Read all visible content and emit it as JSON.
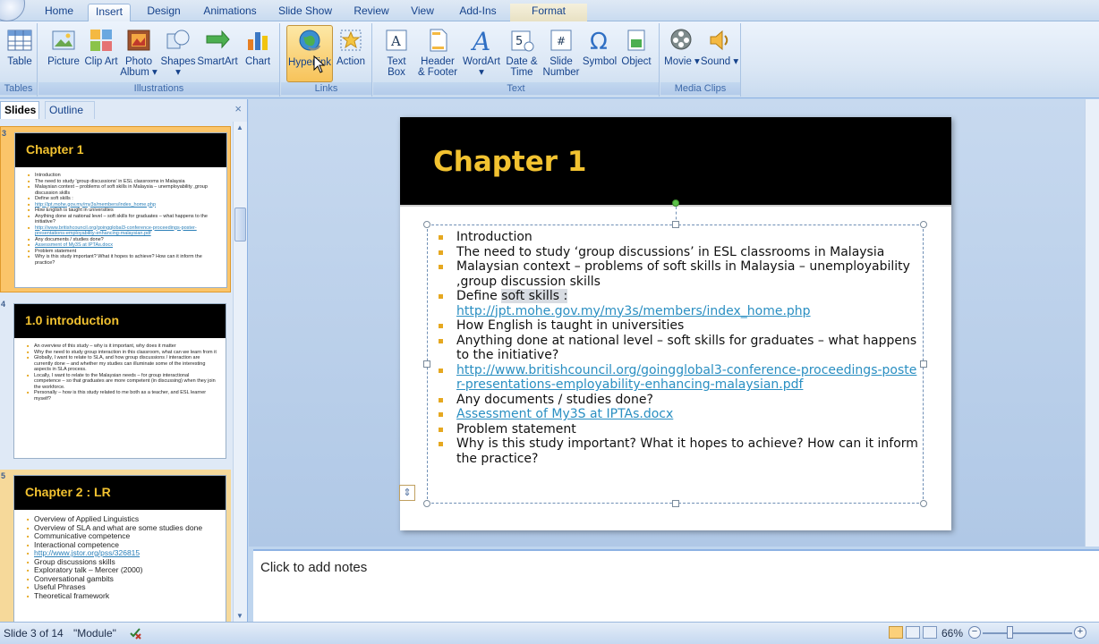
{
  "tabs": [
    "Home",
    "Insert",
    "Design",
    "Animations",
    "Slide Show",
    "Review",
    "View",
    "Add-Ins",
    "Format"
  ],
  "active_tab": "Insert",
  "ribbon": {
    "groups": {
      "tables": "Tables",
      "illustrations": "Illustrations",
      "links": "Links",
      "text": "Text",
      "media": "Media Clips"
    },
    "buttons": {
      "table": "Table",
      "picture": "Picture",
      "clipart": "Clip Art",
      "photoalbum": "Photo Album ▾",
      "shapes": "Shapes ▾",
      "smartart": "SmartArt",
      "chart": "Chart",
      "hyperlink": "Hyperlink",
      "action": "Action",
      "textbox": "Text Box",
      "headerfooter": "Header & Footer",
      "wordart": "WordArt ▾",
      "datetime": "Date & Time",
      "slidenumber": "Slide Number",
      "symbol": "Symbol",
      "object": "Object",
      "movie": "Movie ▾",
      "sound": "Sound ▾"
    }
  },
  "panel": {
    "tabs": [
      "Slides",
      "Outline"
    ],
    "close": "×",
    "thumbs": [
      {
        "number": "3",
        "title": "Chapter 1",
        "lines": [
          "Introduction",
          "The need to study 'group discussions' in ESL classrooms in Malaysia",
          "Malaysian context – problems of soft skills in Malaysia – unemployability ,group discussion skills",
          "Define soft skills :",
          "http://jpt.mohe.gov.my/my3s/members/index_home.php",
          "How English is taught in universities",
          "Anything done at national level – soft skills for graduates – what happens to the initiative?",
          "http://www.britishcouncil.org/goingglobal3-conference-proceedings-poster-presentations-employability-enhancing-malaysian.pdf",
          "Any documents / studies done?",
          "Assessment of My3S at IPTAs.docx",
          "Problem statement",
          "Why is this study important? What it hopes to achieve? How can it inform the practice?"
        ]
      },
      {
        "number": "4",
        "title": "1.0 introduction",
        "lines": [
          "An overview of this study – why is it important, why does it matter",
          "Why the need to study group interaction in this classroom, what can we learn from it",
          "Globally, I want to relate to SLA, and how group discussions / interaction are currently done – and whether my studies can illuminate some of the interesting aspects in SLA process.",
          "Locally, I want to relate to the Malaysian needs – for group interactional competence – so that graduates are more competent (in discussing) when they join the workforce.",
          "Personally – how is this study related to me both as a teacher, and ESL learner myself?"
        ]
      },
      {
        "number": "5",
        "title": "Chapter 2 : LR",
        "lines": [
          "Overview of Applied Linguistics",
          "Overview of SLA and what are some studies done",
          "Communicative competence",
          "Interactional competence",
          "http://www.jstor.org/pss/326815",
          "Group discussions skills",
          "Exploratory talk – Mercer (2000)",
          "Conversational gambits",
          "Useful Phrases",
          "Theoretical framework"
        ]
      }
    ]
  },
  "slide": {
    "title": "Chapter 1",
    "bullets": [
      {
        "text": "Introduction"
      },
      {
        "text": "The need to study ‘group discussions’ in ESL classrooms in Malaysia"
      },
      {
        "text": "Malaysian context – problems of soft skills in Malaysia – unemployability ,group discussion skills"
      },
      {
        "prefix": "Define ",
        "highlight": "soft skills :",
        "link": "http://jpt.mohe.gov.my/my3s/members/index_home.php"
      },
      {
        "text": "How  English is taught in universities"
      },
      {
        "text": "Anything done at national level – soft skills for graduates – what happens to the initiative?"
      },
      {
        "link": "http://www.britishcouncil.org/goingglobal3-conference-proceedings-poster-presentations-employability-enhancing-malaysian.pdf"
      },
      {
        "text": "Any documents / studies done?"
      },
      {
        "link": "Assessment of My3S at IPTAs.docx"
      },
      {
        "text": "Problem statement"
      },
      {
        "text": "Why is this study important? What it hopes to achieve? How can it inform the practice?"
      }
    ]
  },
  "notes": {
    "placeholder": "Click to add notes"
  },
  "status": {
    "slide": "Slide 3 of 14",
    "theme": "\"Module\"",
    "zoom": "66%",
    "zoom_level": 0.3
  },
  "colors": {
    "title_text": "#f2c230",
    "bullet": "#e6a820",
    "link": "#2a8fc2",
    "slide_title_bg": "#000000"
  }
}
